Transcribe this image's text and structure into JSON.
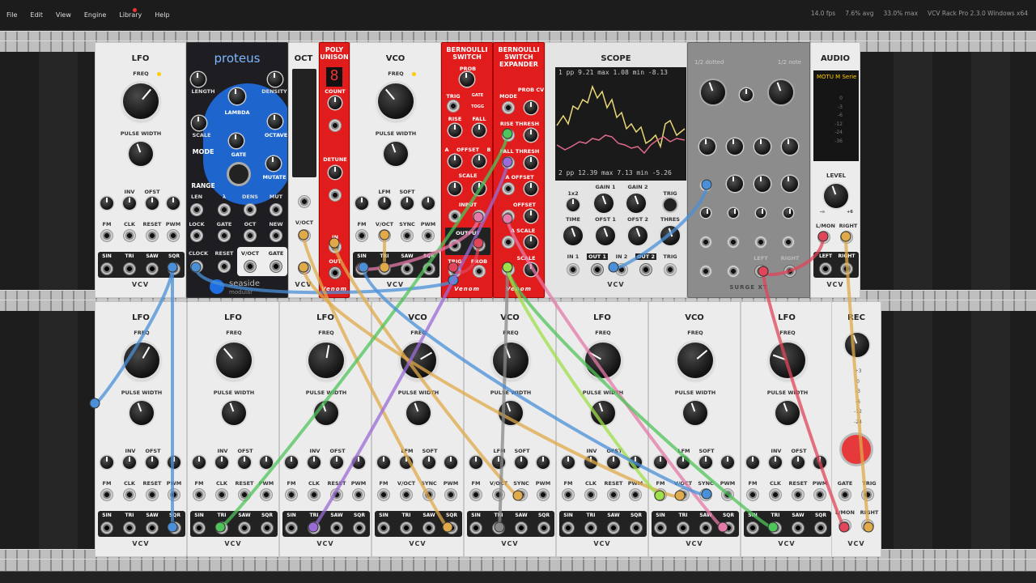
{
  "menubar": {
    "items": [
      "File",
      "Edit",
      "View",
      "Engine",
      "Library",
      "Help"
    ],
    "stats": [
      "14.0 fps",
      "7.6% avg",
      "33.0% max"
    ],
    "version": "VCV Rack Pro 2.3.0 Windows x64"
  },
  "brand": "VCV",
  "top_row": {
    "lfo": {
      "title": "LFO",
      "freq": "FREQ",
      "pulse_width": "PULSE WIDTH",
      "inv": "INV",
      "ofst": "OFST",
      "fm": "FM",
      "clk": "CLK",
      "reset": "RESET",
      "pwm": "PWM",
      "outs": [
        "SIN",
        "TRI",
        "SAW",
        "SQR"
      ]
    },
    "proteus": {
      "title": "proteus",
      "length": "LENGTH",
      "density": "DENSITY",
      "lambda": "LAMBDA",
      "scale": "SCALE",
      "octave": "OCTAVE",
      "mode": "MODE",
      "gate": "GATE",
      "mutate": "MUTATE",
      "range": "RANGE",
      "jacks_row1": [
        "LEN",
        "λ",
        "DENS",
        "MUT"
      ],
      "jacks_row2": [
        "LOCK",
        "GATE",
        "OCT",
        "NEW"
      ],
      "jacks_row3": [
        "CLOCK",
        "RESET",
        "V/OCT",
        "GATE"
      ],
      "logo": "seaside",
      "logo_sub": "modular"
    },
    "oct": {
      "title": "OCT",
      "voct": "V/OCT"
    },
    "poly_unison": {
      "title_line1": "POLY",
      "title_line2": "UNISON",
      "digit": "8",
      "count": "COUNT",
      "detune": "DETUNE",
      "in": "IN",
      "out": "OUT",
      "brand": "Venom"
    },
    "vco": {
      "title": "VCO",
      "freq": "FREQ",
      "pulse_width": "PULSE WIDTH",
      "lfm": "LFM",
      "soft": "SOFT",
      "fm": "FM",
      "voct": "V/OCT",
      "sync": "SYNC",
      "pwm": "PWM",
      "outs": [
        "SIN",
        "TRI",
        "SAW",
        "SQR"
      ]
    },
    "bernoulli_switch": {
      "title_line1": "BERNOULLI",
      "title_line2": "SWITCH",
      "prob": "PROB",
      "trig": "TRIG",
      "gate": "GATE",
      "toggle": "TOGG",
      "rise": "RISE",
      "fall": "FALL",
      "offset": "OFFSET",
      "scale": "SCALE",
      "input": "INPUT",
      "output": "OUTPUT",
      "prob_jack": "PROB",
      "a": "A",
      "b": "B",
      "brand": "Venom"
    },
    "bernoulli_expander": {
      "title_line1": "BERNOULLI",
      "title_line2": "SWITCH",
      "title_line3": "EXPANDER",
      "mode": "MODE",
      "prob_cv": "PROB CV",
      "rise_thresh": "RISE THRESH",
      "fall_thresh": "FALL THRESH",
      "a_offset": "A OFFSET",
      "b_offset": "OFFSET",
      "a_scale": "A SCALE",
      "b_scale": "SCALE",
      "brand": "Venom"
    },
    "scope": {
      "title": "SCOPE",
      "readout_top": [
        "1",
        "pp",
        "9.21",
        "max",
        "1.08",
        "min",
        "-8.13"
      ],
      "readout_bottom": [
        "2",
        "pp",
        "12.39",
        "max",
        "7.13",
        "min",
        "-5.26"
      ],
      "x1x2": "1x2",
      "gain1": "GAIN 1",
      "gain2": "GAIN 2",
      "trig": "TRIG",
      "time": "TIME",
      "ofst1": "OFST 1",
      "ofst2": "OFST 2",
      "thres": "THRES",
      "jacks": [
        "IN 1",
        "OUT 1",
        "IN 2",
        "OUT 2",
        "TRIG"
      ]
    },
    "surge": {
      "label_left": "1/2 dotted",
      "label_right": "1/2 note",
      "channel_labels": [
        "LEFT",
        "RIGHT"
      ],
      "brand": "SURGE XT"
    },
    "audio": {
      "title": "AUDIO",
      "device": "MOTU M Serie",
      "meter_scale": [
        "0",
        "-3",
        "-6",
        "-12",
        "-24",
        "-36"
      ],
      "level": "LEVEL",
      "level_min": "-∞",
      "level_max": "+6",
      "lmon": "L/MON",
      "right": "RIGHT",
      "left": "LEFT"
    }
  },
  "bottom_row": {
    "modules": [
      {
        "title": "LFO",
        "kind": "lfo"
      },
      {
        "title": "LFO",
        "kind": "lfo"
      },
      {
        "title": "LFO",
        "kind": "lfo"
      },
      {
        "title": "VCO",
        "kind": "vco"
      },
      {
        "title": "VCO",
        "kind": "vco"
      },
      {
        "title": "LFO",
        "kind": "lfo"
      },
      {
        "title": "VCO",
        "kind": "vco"
      },
      {
        "title": "LFO",
        "kind": "lfo"
      }
    ],
    "lfo_labels": {
      "freq": "FREQ",
      "pulse_width": "PULSE WIDTH",
      "inv": "INV",
      "ofst": "OFST",
      "fm": "FM",
      "clk": "CLK",
      "reset": "RESET",
      "pwm": "PWM"
    },
    "vco_labels": {
      "freq": "FREQ",
      "pulse_width": "PULSE WIDTH",
      "lfm": "LFM",
      "soft": "SOFT",
      "fm": "FM",
      "voct": "V/OCT",
      "sync": "SYNC",
      "pwm": "PWM"
    },
    "outs": [
      "SIN",
      "TRI",
      "SAW",
      "SQR"
    ],
    "rec": {
      "title": "REC",
      "meter_scale": [
        "+3",
        "0",
        "-3",
        "-6",
        "-12",
        "-24"
      ],
      "gate": "GATE",
      "trig": "TRIG",
      "lmon": "L/MON",
      "right": "RIGHT",
      "button_color": "#e5393b"
    }
  },
  "cable_colors": {
    "blue": "#4a90d9",
    "orange": "#e0a94a",
    "green": "#4fc45a",
    "purple": "#9b6cd6",
    "pink": "#e47aa8",
    "red": "#e0455a",
    "grey": "#888888",
    "lime": "#9fe04a"
  }
}
